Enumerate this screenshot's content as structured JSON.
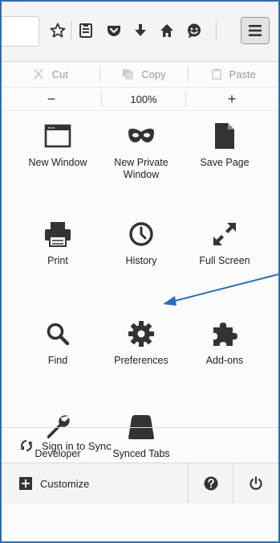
{
  "edit": {
    "cut": "Cut",
    "copy": "Copy",
    "paste": "Paste"
  },
  "zoom": {
    "minus": "−",
    "level": "100%",
    "plus": "+"
  },
  "grid": [
    {
      "label": "New Window",
      "icon": "window-icon"
    },
    {
      "label": "New Private Window",
      "icon": "mask-icon"
    },
    {
      "label": "Save Page",
      "icon": "document-icon"
    },
    {
      "label": "Print",
      "icon": "printer-icon"
    },
    {
      "label": "History",
      "icon": "clock-icon"
    },
    {
      "label": "Full Screen",
      "icon": "fullscreen-icon"
    },
    {
      "label": "Find",
      "icon": "magnifier-icon"
    },
    {
      "label": "Preferences",
      "icon": "gear-icon"
    },
    {
      "label": "Add-ons",
      "icon": "puzzle-icon"
    },
    {
      "label": "Developer",
      "icon": "wrench-icon"
    },
    {
      "label": "Synced Tabs",
      "icon": "synced-tabs-icon"
    }
  ],
  "footer": {
    "sign_in": "Sign in to Sync",
    "customize": "Customize"
  },
  "colors": {
    "frame": "#2f6db5",
    "arrow": "#2f6db5",
    "icon": "#333333"
  }
}
